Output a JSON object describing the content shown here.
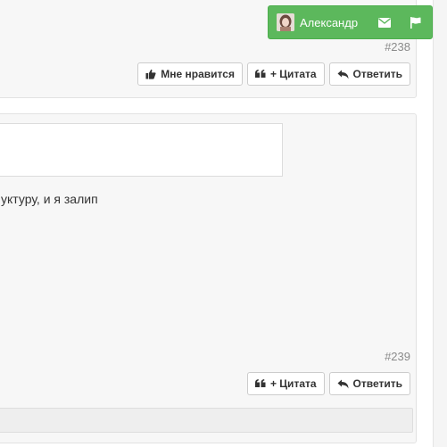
{
  "posts": [
    {
      "number": "#238",
      "buttons": [
        {
          "icon": "thumbs-up-icon",
          "label": "Мне нравится"
        },
        {
          "icon": "quote-icon",
          "label": "+ Цитата"
        },
        {
          "icon": "reply-icon",
          "label": "Ответить"
        }
      ]
    },
    {
      "text": "уктуру, и я залип",
      "number": "#239",
      "buttons": [
        {
          "icon": "quote-icon",
          "label": "+ Цитата"
        },
        {
          "icon": "reply-icon",
          "label": "Ответить"
        }
      ]
    }
  ],
  "user_bar": {
    "name": "Александр",
    "icons": [
      "envelope-icon",
      "flag-icon"
    ],
    "color": "#5cb85c"
  }
}
